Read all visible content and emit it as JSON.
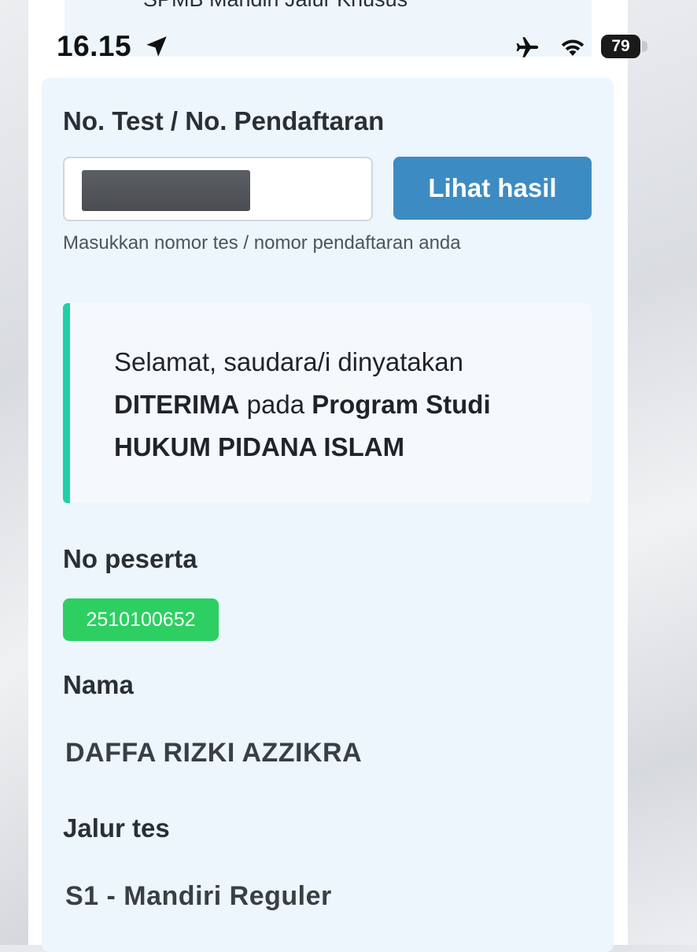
{
  "status_bar": {
    "time": "16.15",
    "battery": "79",
    "icons": [
      "location-arrow-icon",
      "airplane-icon",
      "wifi-icon",
      "battery-icon"
    ]
  },
  "banner": {
    "text": "SPMB Mandiri Jalur Khusus"
  },
  "form": {
    "label": "No. Test / No. Pendaftaran",
    "input_value": "",
    "button_label": "Lihat hasil",
    "hint": "Masukkan nomor tes / nomor pendaftaran anda"
  },
  "result": {
    "line1": "Selamat, saudara/i dinyatakan",
    "status": "DITERIMA",
    "mid": " pada ",
    "program_label": "Program Studi",
    "program_name": "HUKUM PIDANA ISLAM"
  },
  "details": {
    "no_peserta_label": "No peserta",
    "no_peserta_value": "2510100652",
    "nama_label": "Nama",
    "nama_value": "DAFFA RIZKI AZZIKRA",
    "jalur_label": "Jalur tes",
    "jalur_value": "S1 - Mandiri Reguler"
  },
  "colors": {
    "button": "#3d8bc3",
    "badge": "#2dcf62",
    "accent_border": "#1fd2a6",
    "card_bg": "#edf5fd"
  }
}
